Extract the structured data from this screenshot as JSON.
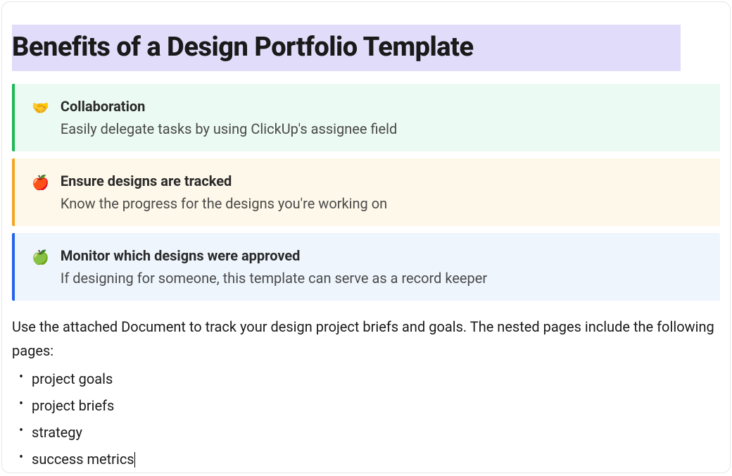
{
  "heading": "Benefits of a Design Portfolio Template",
  "callouts": [
    {
      "icon": "🤝",
      "title": "Collaboration",
      "body": "Easily delegate tasks by using ClickUp's assignee field",
      "accent": "green"
    },
    {
      "icon": "🍎",
      "title": "Ensure designs are tracked",
      "body": "Know the progress for the designs you're working on",
      "accent": "orange"
    },
    {
      "icon": "🍏",
      "title": "Monitor which designs were approved",
      "body": "If designing for someone, this template can serve as a record keeper",
      "accent": "blue"
    }
  ],
  "paragraph": "Use the attached Document to track your design project briefs and goals. The nested pages include the following pages:",
  "bullets": [
    "project goals",
    "project briefs",
    "strategy",
    "success metrics"
  ]
}
